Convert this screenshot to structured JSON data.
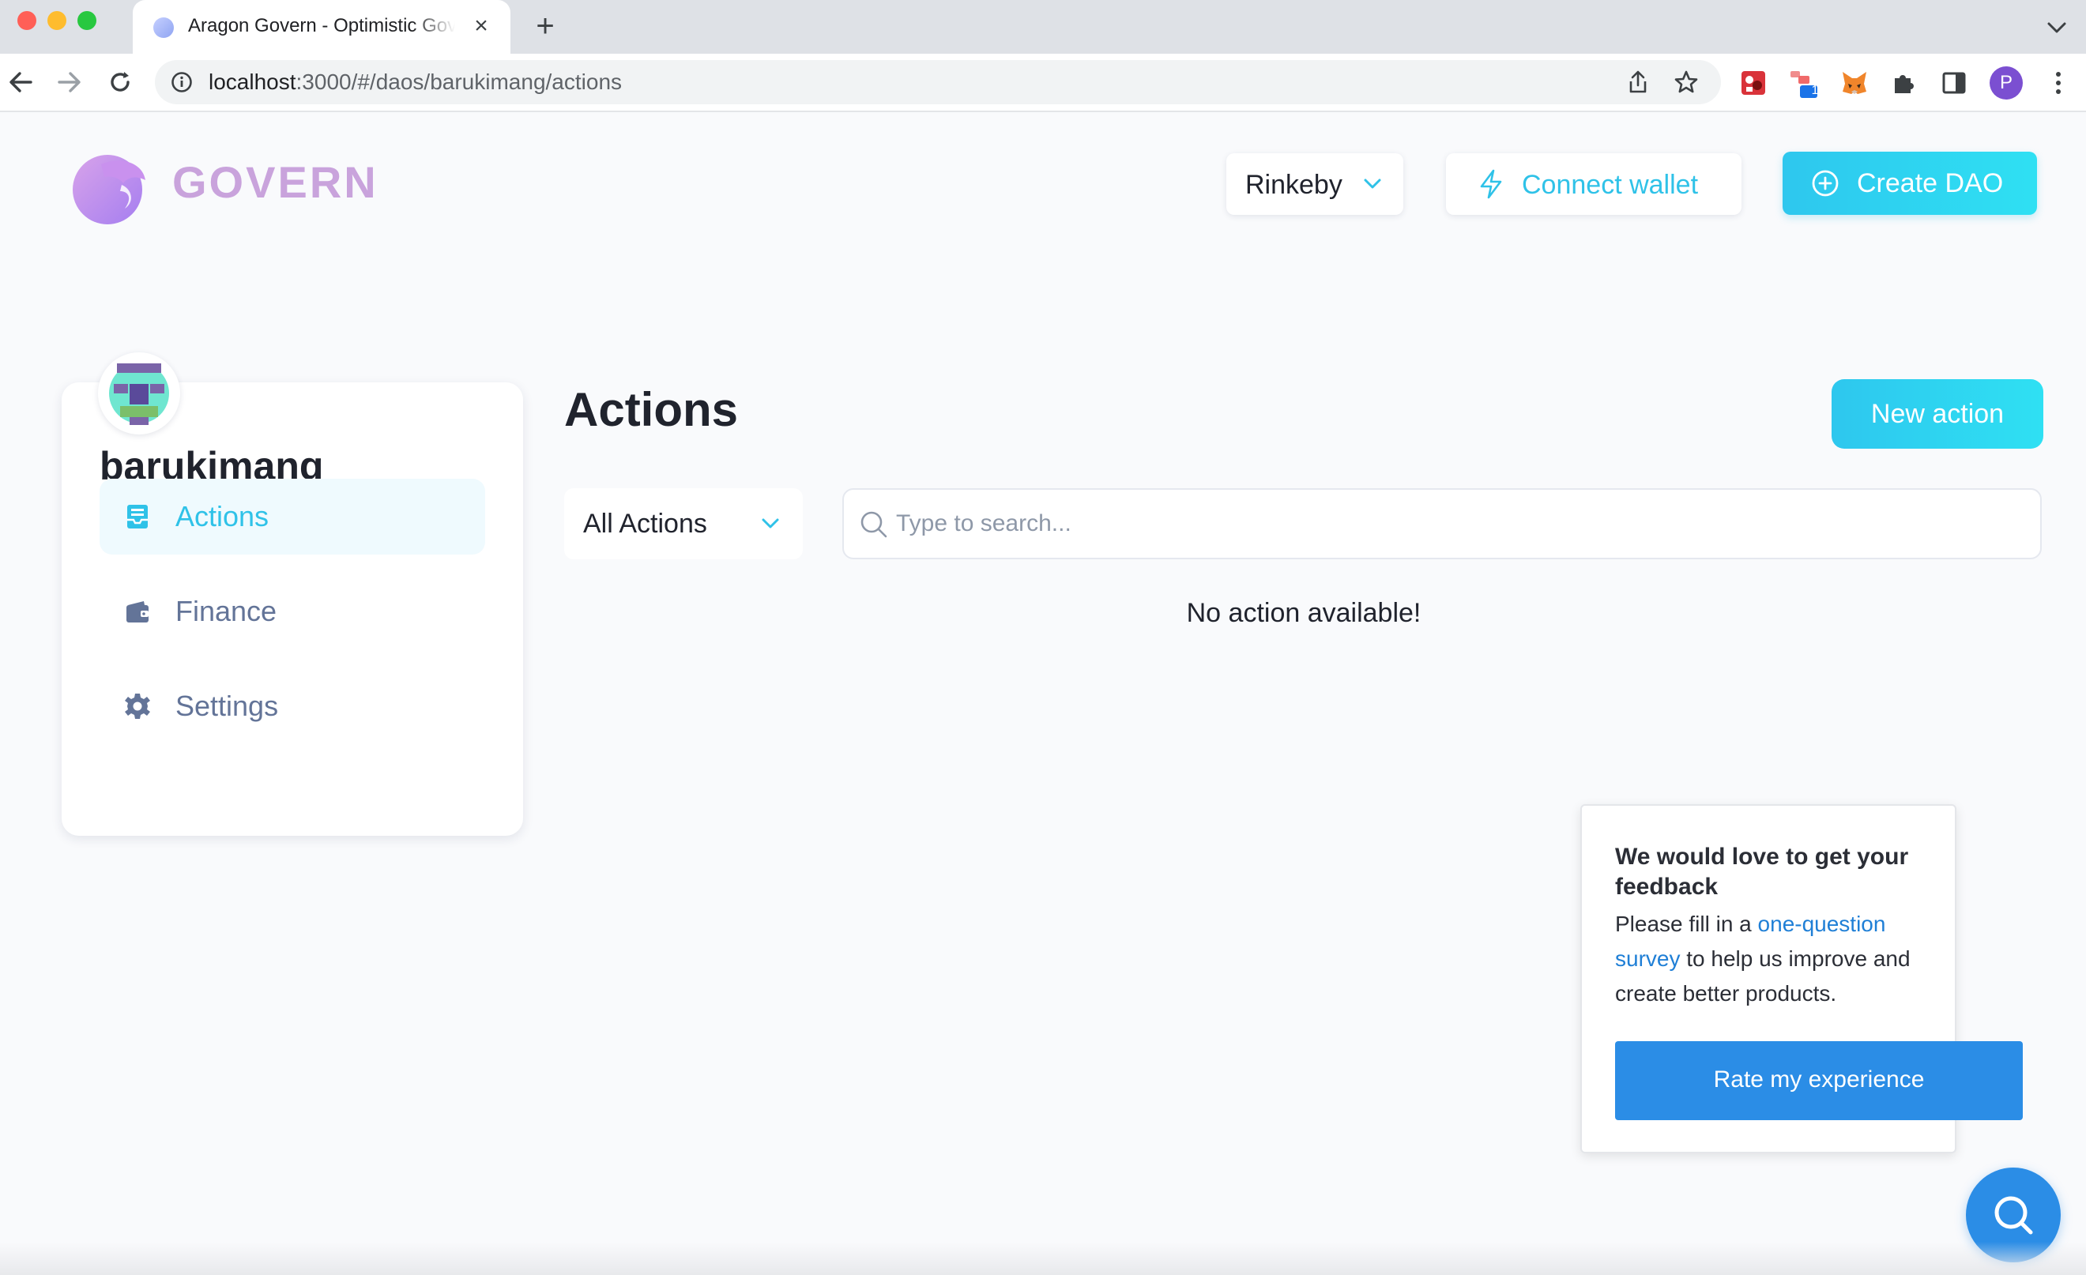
{
  "browser": {
    "tab_title": "Aragon Govern - Optimistic Governance",
    "url_host": "localhost",
    "url_rest": ":3000/#/daos/barukimang/actions",
    "profile_initial": "P",
    "extension_badge": "1"
  },
  "header": {
    "logo_text": "GOVERN",
    "network_label": "Rinkeby",
    "connect_label": "Connect wallet",
    "create_label": "Create DAO"
  },
  "sidebar": {
    "dao_name": "barukimang",
    "items": [
      {
        "label": "Actions",
        "icon": "inbox-icon",
        "active": true
      },
      {
        "label": "Finance",
        "icon": "wallet-icon",
        "active": false
      },
      {
        "label": "Settings",
        "icon": "gear-icon",
        "active": false
      }
    ]
  },
  "main": {
    "title": "Actions",
    "new_action_label": "New action",
    "filter_label": "All Actions",
    "search_placeholder": "Type to search...",
    "empty_message": "No action available!"
  },
  "feedback": {
    "title": "We would love to get your feedback",
    "body_before": "Please fill in a ",
    "link_text": "one-question survey",
    "body_after": " to help us improve and create better products.",
    "button_label": "Rate my experience"
  },
  "colors": {
    "accent": "#2fc2e8",
    "nav_text": "#637498",
    "feedback_button": "#2b8de6",
    "logo": "#c9a3dc"
  }
}
